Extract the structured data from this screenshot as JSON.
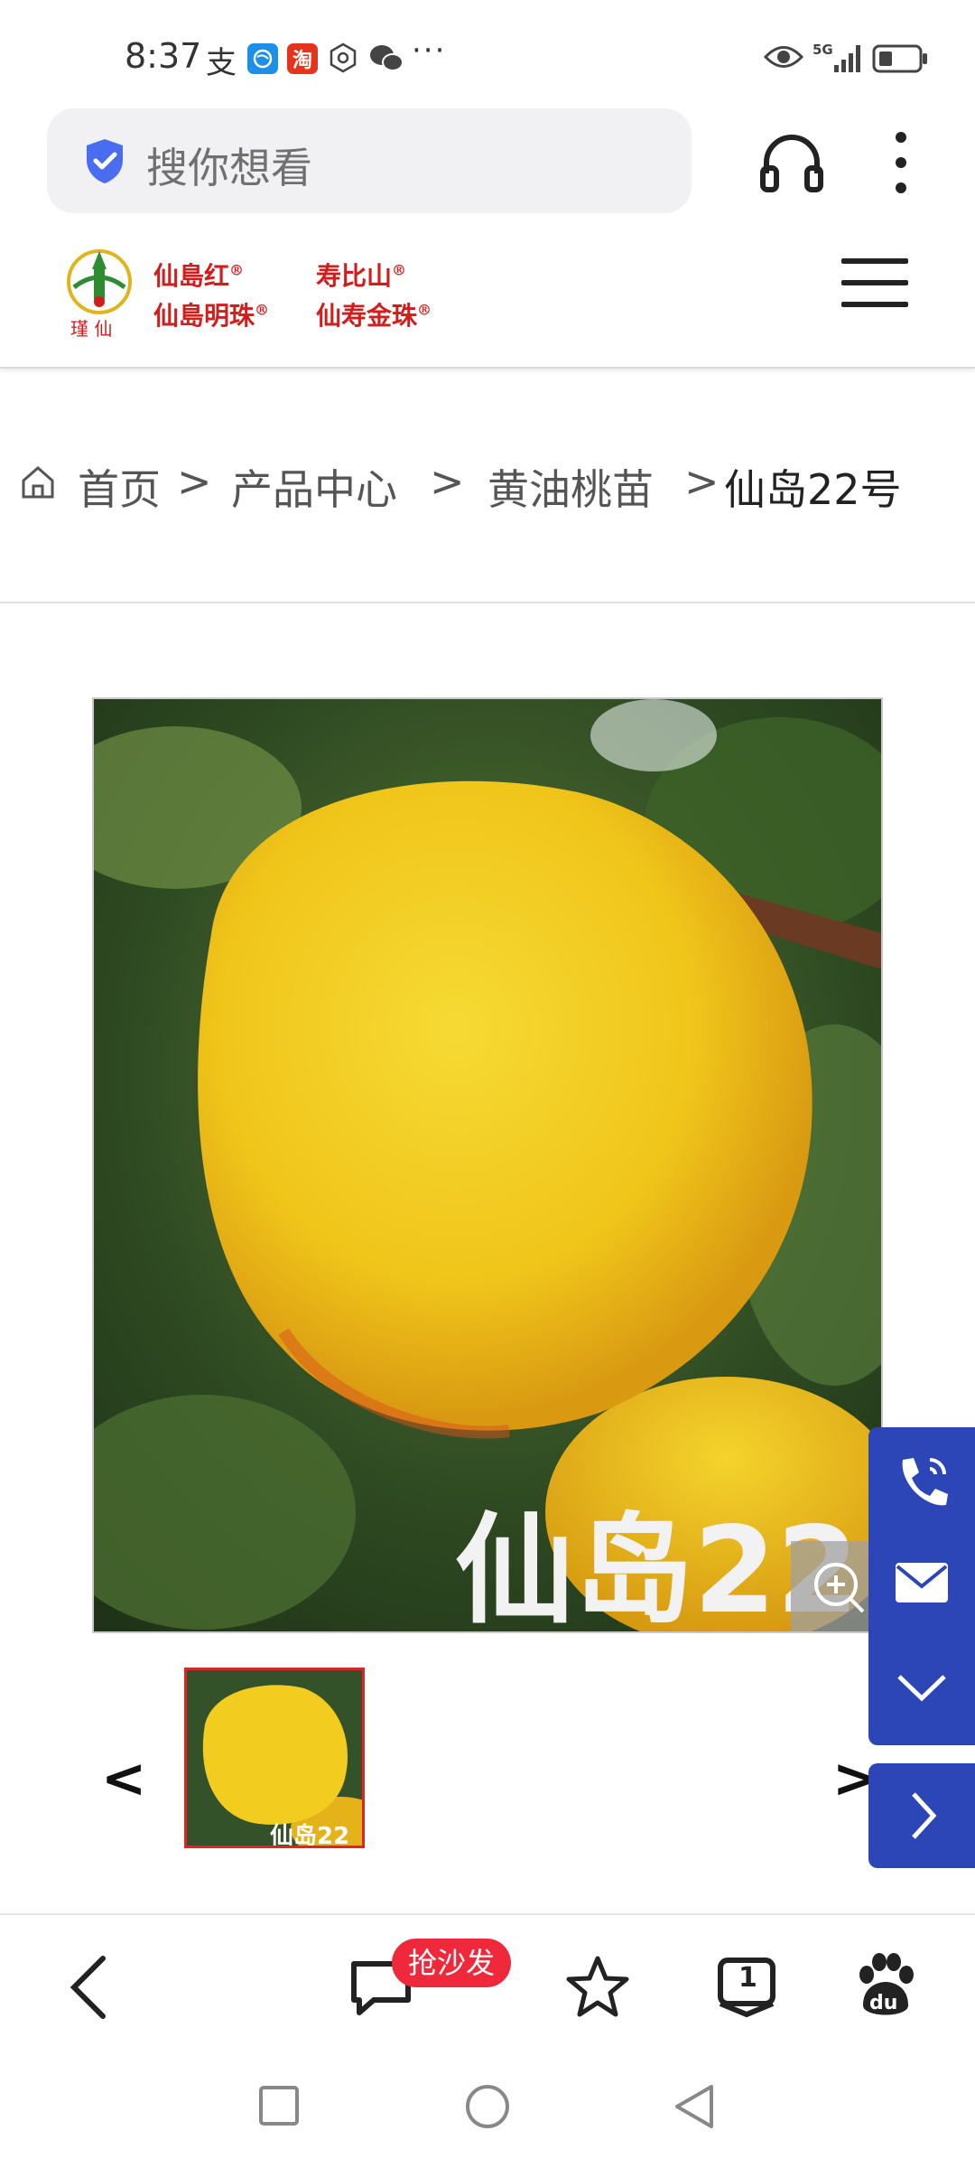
{
  "status_bar": {
    "time": "8:37",
    "alipay_glyph": "支",
    "taobao_glyph": "淘",
    "more": "···",
    "network": "5G",
    "icons": [
      "alipay-icon",
      "browser-icon",
      "taobao-icon",
      "settings-icon",
      "wechat-icon",
      "eye-icon",
      "signal-icon",
      "battery-icon"
    ]
  },
  "search": {
    "placeholder": "搜你想看"
  },
  "site": {
    "brand_lines": [
      "仙島红®",
      "寿比山®",
      "仙島明珠®",
      "仙寿金珠®"
    ],
    "logo_caption": "瑾 仙"
  },
  "breadcrumb": {
    "home": "首页",
    "sep1": ">",
    "product_center": "产品中心",
    "sep2": ">",
    "category": "黄油桃苗",
    "sep3": ">",
    "current": "仙岛22号"
  },
  "product": {
    "image_caption": "仙岛22",
    "thumb_caption": "仙岛22"
  },
  "gallery": {
    "prev": "<",
    "next": ">"
  },
  "toolbar": {
    "sofa_badge": "抢沙发",
    "tab_count": "1",
    "baidu": "du"
  },
  "colors": {
    "accent_blue": "#2c46b8",
    "brand_red": "#d21d1d",
    "badge_red": "#f0283c",
    "peach_yellow": "#f2cc1e"
  }
}
